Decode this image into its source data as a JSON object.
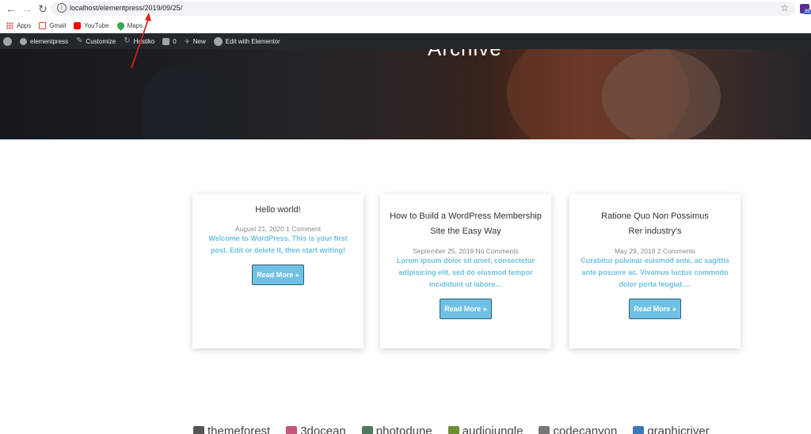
{
  "browser": {
    "url": "localhost/elementpress/2019/09/25/",
    "extension_badge": "35",
    "bookmarks": [
      {
        "label": "Apps"
      },
      {
        "label": "Gmail"
      },
      {
        "label": "YouTube"
      },
      {
        "label": "Maps"
      }
    ]
  },
  "admin_bar": {
    "site": "elementpress",
    "customize": "Customize",
    "theme": "Hostiko",
    "comments": "0",
    "new": "New",
    "elementor": "Edit with Elementor"
  },
  "hero": {
    "title": "Archive"
  },
  "posts": [
    {
      "title": "Hello world!",
      "meta": "August 21, 2020 1 Comment",
      "excerpt": "Welcome to WordPress. This is your first post. Edit or delete it, then start writing!",
      "button": "Read More »"
    },
    {
      "title": "How to Build a WordPress Membership Site the Easy Way",
      "meta": "September 25, 2019 No Comments",
      "excerpt": "Lorem ipsum dolor sit amet, consectetur adipisicing elit, sed do eiusmod tempor incididunt ut labore…",
      "button": "Read More »"
    },
    {
      "title": "Ratione Quo Non Possimus Rer industry's",
      "meta": "May 29, 2018 2 Comments",
      "excerpt": "Curabitur pulvinar euismod ante, ac sagittis ante posuere ac. Vivamus luctus commodo dolor porta feugiat.…",
      "button": "Read More »"
    }
  ],
  "partner_logos": [
    "themeforest",
    "3docean",
    "photodune",
    "audiojungle",
    "codecanyon",
    "graphicriver"
  ]
}
